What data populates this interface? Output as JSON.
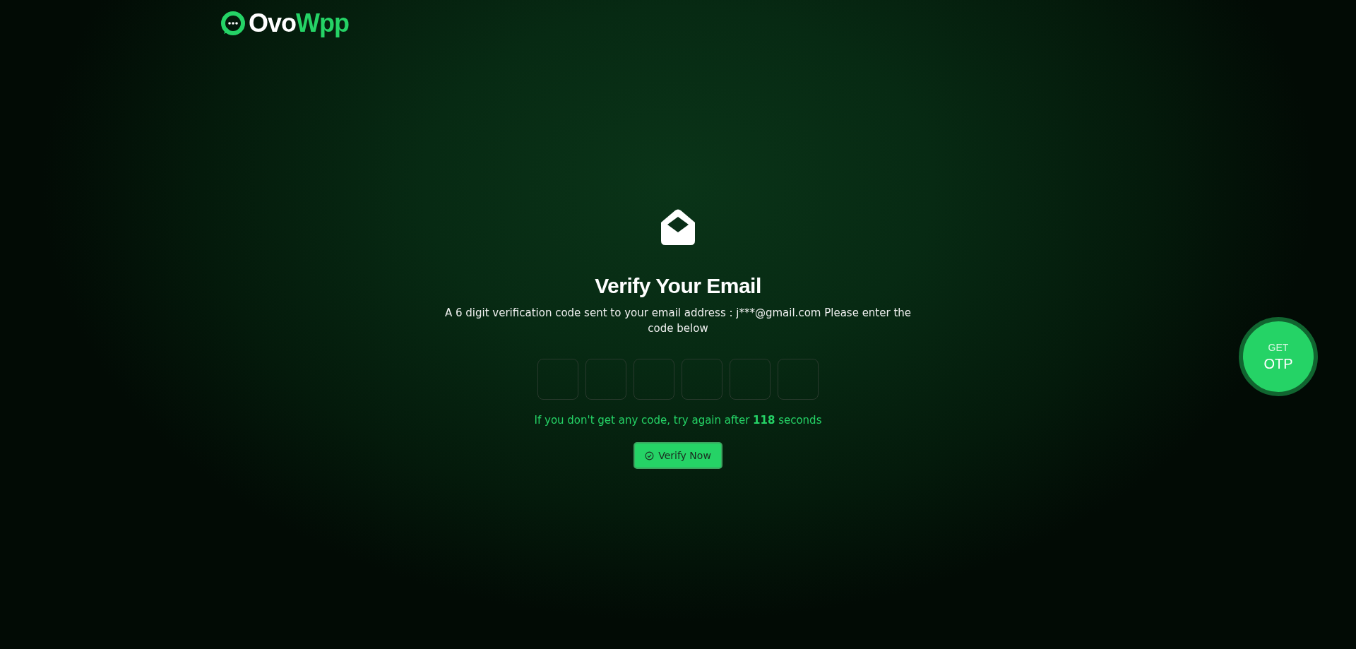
{
  "logo": {
    "first": "Ovo",
    "second": "Wpp"
  },
  "heading": "Verify Your Email",
  "message": "A 6 digit verification code sent to your email address : j***@gmail.com Please enter the code below",
  "otp_fields": [
    {
      "kind": "digit"
    },
    {
      "kind": "digit"
    },
    {
      "kind": "digit"
    },
    {
      "kind": "digit"
    },
    {
      "kind": "digit"
    },
    {
      "kind": "digit"
    }
  ],
  "timer_note": "If you don't get any code, try again after **118** seconds",
  "verify_button": "Verify Now",
  "get_otp": {
    "line_1": "GET",
    "line_2": "OTP"
  }
}
